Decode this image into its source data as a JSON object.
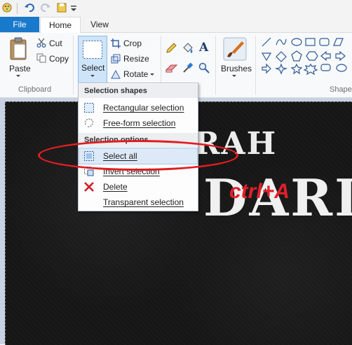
{
  "ribbon_tabs": {
    "file": "File",
    "home": "Home",
    "view": "View"
  },
  "clipboard": {
    "paste": "Paste",
    "cut": "Cut",
    "copy": "Copy",
    "group_label": "Clipboard"
  },
  "image_group": {
    "select": "Select",
    "crop": "Crop",
    "resize": "Resize",
    "rotate": "Rotate"
  },
  "brushes": {
    "label": "Brushes"
  },
  "shapes": {
    "group_label": "Shape"
  },
  "menu": {
    "header_shapes": "Selection shapes",
    "rectangular": "Rectangular selection",
    "freeform": "Free-form selection",
    "header_options": "Selection options",
    "select_all": "Select all",
    "invert": "Invert selection",
    "delete": "Delete",
    "transparent": "Transparent selection"
  },
  "canvas": {
    "line1": "HIJRAH",
    "line2": "DARI",
    "annotation": "ctrl+A"
  },
  "colors": {
    "accent": "#1979ca",
    "annotation": "#e3202a",
    "highlight": "#dde9f7"
  }
}
